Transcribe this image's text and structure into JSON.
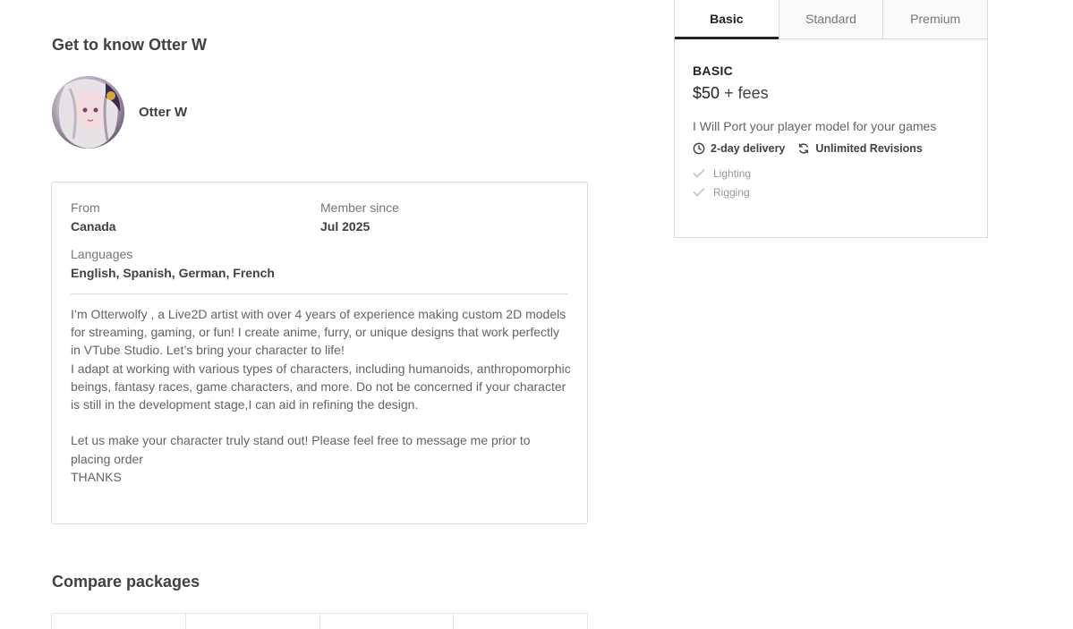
{
  "about": {
    "title": "Get to know Otter W",
    "seller_name": "Otter W",
    "from_label": "From",
    "from_value": "Canada",
    "member_label": "Member since",
    "member_value": "Jul 2025",
    "languages_label": "Languages",
    "languages_value": "English, Spanish, German, French",
    "bio": "I’m Otterwolfy , a Live2D artist with over 4 years of experience making custom 2D models for streaming, gaming, or fun! I create anime, furry, or unique designs that work perfectly in VTube Studio. Let’s bring your character to life!\nI adapt at working with various types of characters, including humanoids, anthropomorphic beings, fantasy races, game characters, and more. Do not be concerned if your character is still in the development stage,I can aid in refining the design.\n\nLet us make your character truly stand out! Please feel free to message me prior to placing order\nTHANKS"
  },
  "compare": {
    "title": "Compare packages"
  },
  "package_panel": {
    "tabs": [
      {
        "label": "Basic",
        "active": true
      },
      {
        "label": "Standard",
        "active": false
      },
      {
        "label": "Premium",
        "active": false
      }
    ],
    "name": "BASIC",
    "price": "$50",
    "fees": "+ fees",
    "description": "I Will Port your player model for your games",
    "delivery": "2-day delivery",
    "revisions": "Unlimited Revisions",
    "features": [
      "Lighting",
      "Rigging"
    ],
    "icons": {
      "delivery": "clock-icon",
      "revisions": "refresh-icon",
      "feature": "check-icon"
    }
  }
}
